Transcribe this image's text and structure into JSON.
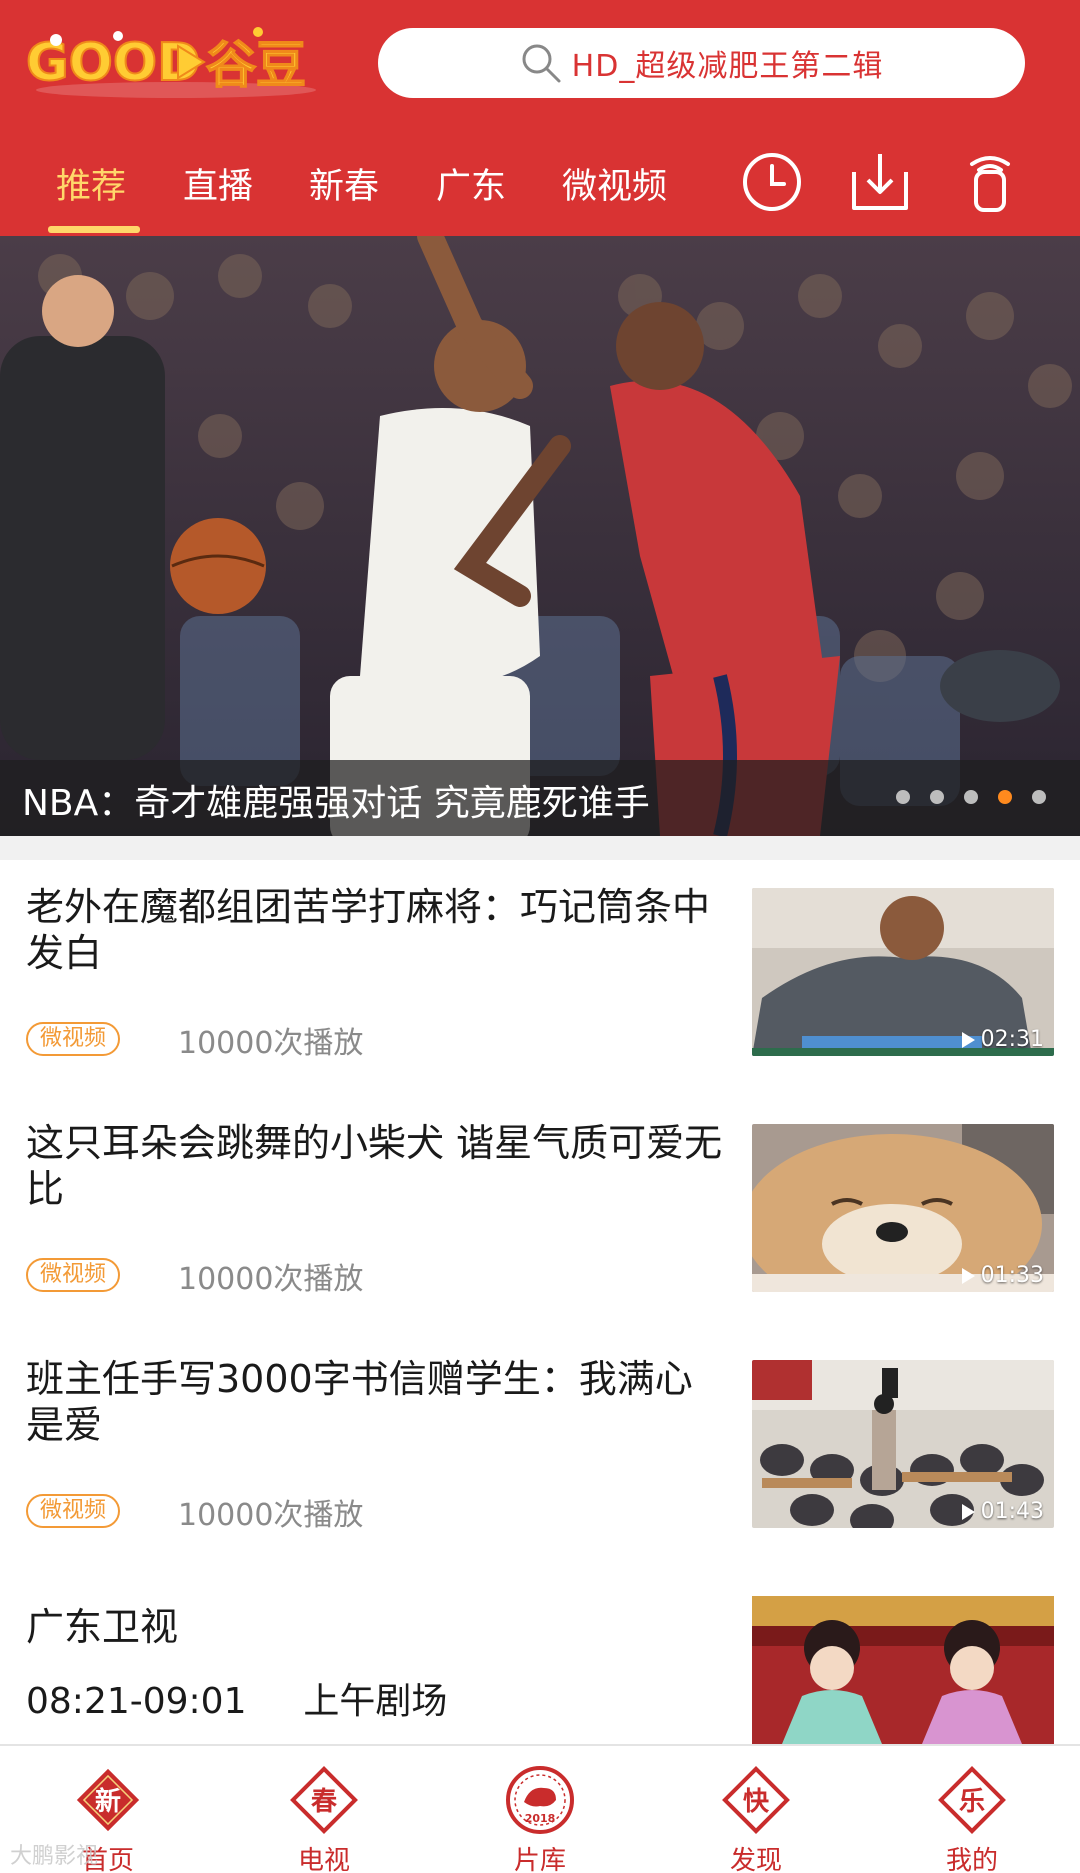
{
  "header": {
    "logo_text": "GOOD谷豆",
    "search_placeholder": "HD_超级减肥王第二辑",
    "tabs": [
      {
        "label": "推荐",
        "active": true
      },
      {
        "label": "直播",
        "active": false
      },
      {
        "label": "新春",
        "active": false
      },
      {
        "label": "广东",
        "active": false
      },
      {
        "label": "微视频",
        "active": false
      }
    ],
    "icons": [
      "history-clock-icon",
      "download-icon",
      "cast-icon"
    ]
  },
  "banner": {
    "title": "NBA：奇才雄鹿强强对话 究竟鹿死谁手",
    "dot_count": 5,
    "active_dot": 4
  },
  "feed": [
    {
      "title": "老外在魔都组团苦学打麻将：巧记筒条中发白",
      "tag": "微视频",
      "plays": "10000次播放",
      "duration": "02:31"
    },
    {
      "title": "这只耳朵会跳舞的小柴犬 谐星气质可爱无比",
      "tag": "微视频",
      "plays": "10000次播放",
      "duration": "01:33"
    },
    {
      "title": "班主任手写3000字书信赠学生：我满心是爱",
      "tag": "微视频",
      "plays": "10000次播放",
      "duration": "01:43"
    }
  ],
  "tv_item": {
    "channel": "广东卫视",
    "time": "08:21-09:01",
    "program": "上午剧场"
  },
  "bottom_nav": {
    "items": [
      {
        "badge": "新",
        "label": "首页"
      },
      {
        "badge": "春",
        "label": "电视"
      },
      {
        "badge": "2018",
        "label": "片库"
      },
      {
        "badge": "快",
        "label": "发现"
      },
      {
        "badge": "乐",
        "label": "我的"
      }
    ],
    "watermark": "大鹏影视"
  },
  "colors": {
    "brand_red": "#d93333",
    "active_tab": "#ffd76a",
    "tag_orange": "#f39a36",
    "active_dot": "#ff8a1e"
  }
}
